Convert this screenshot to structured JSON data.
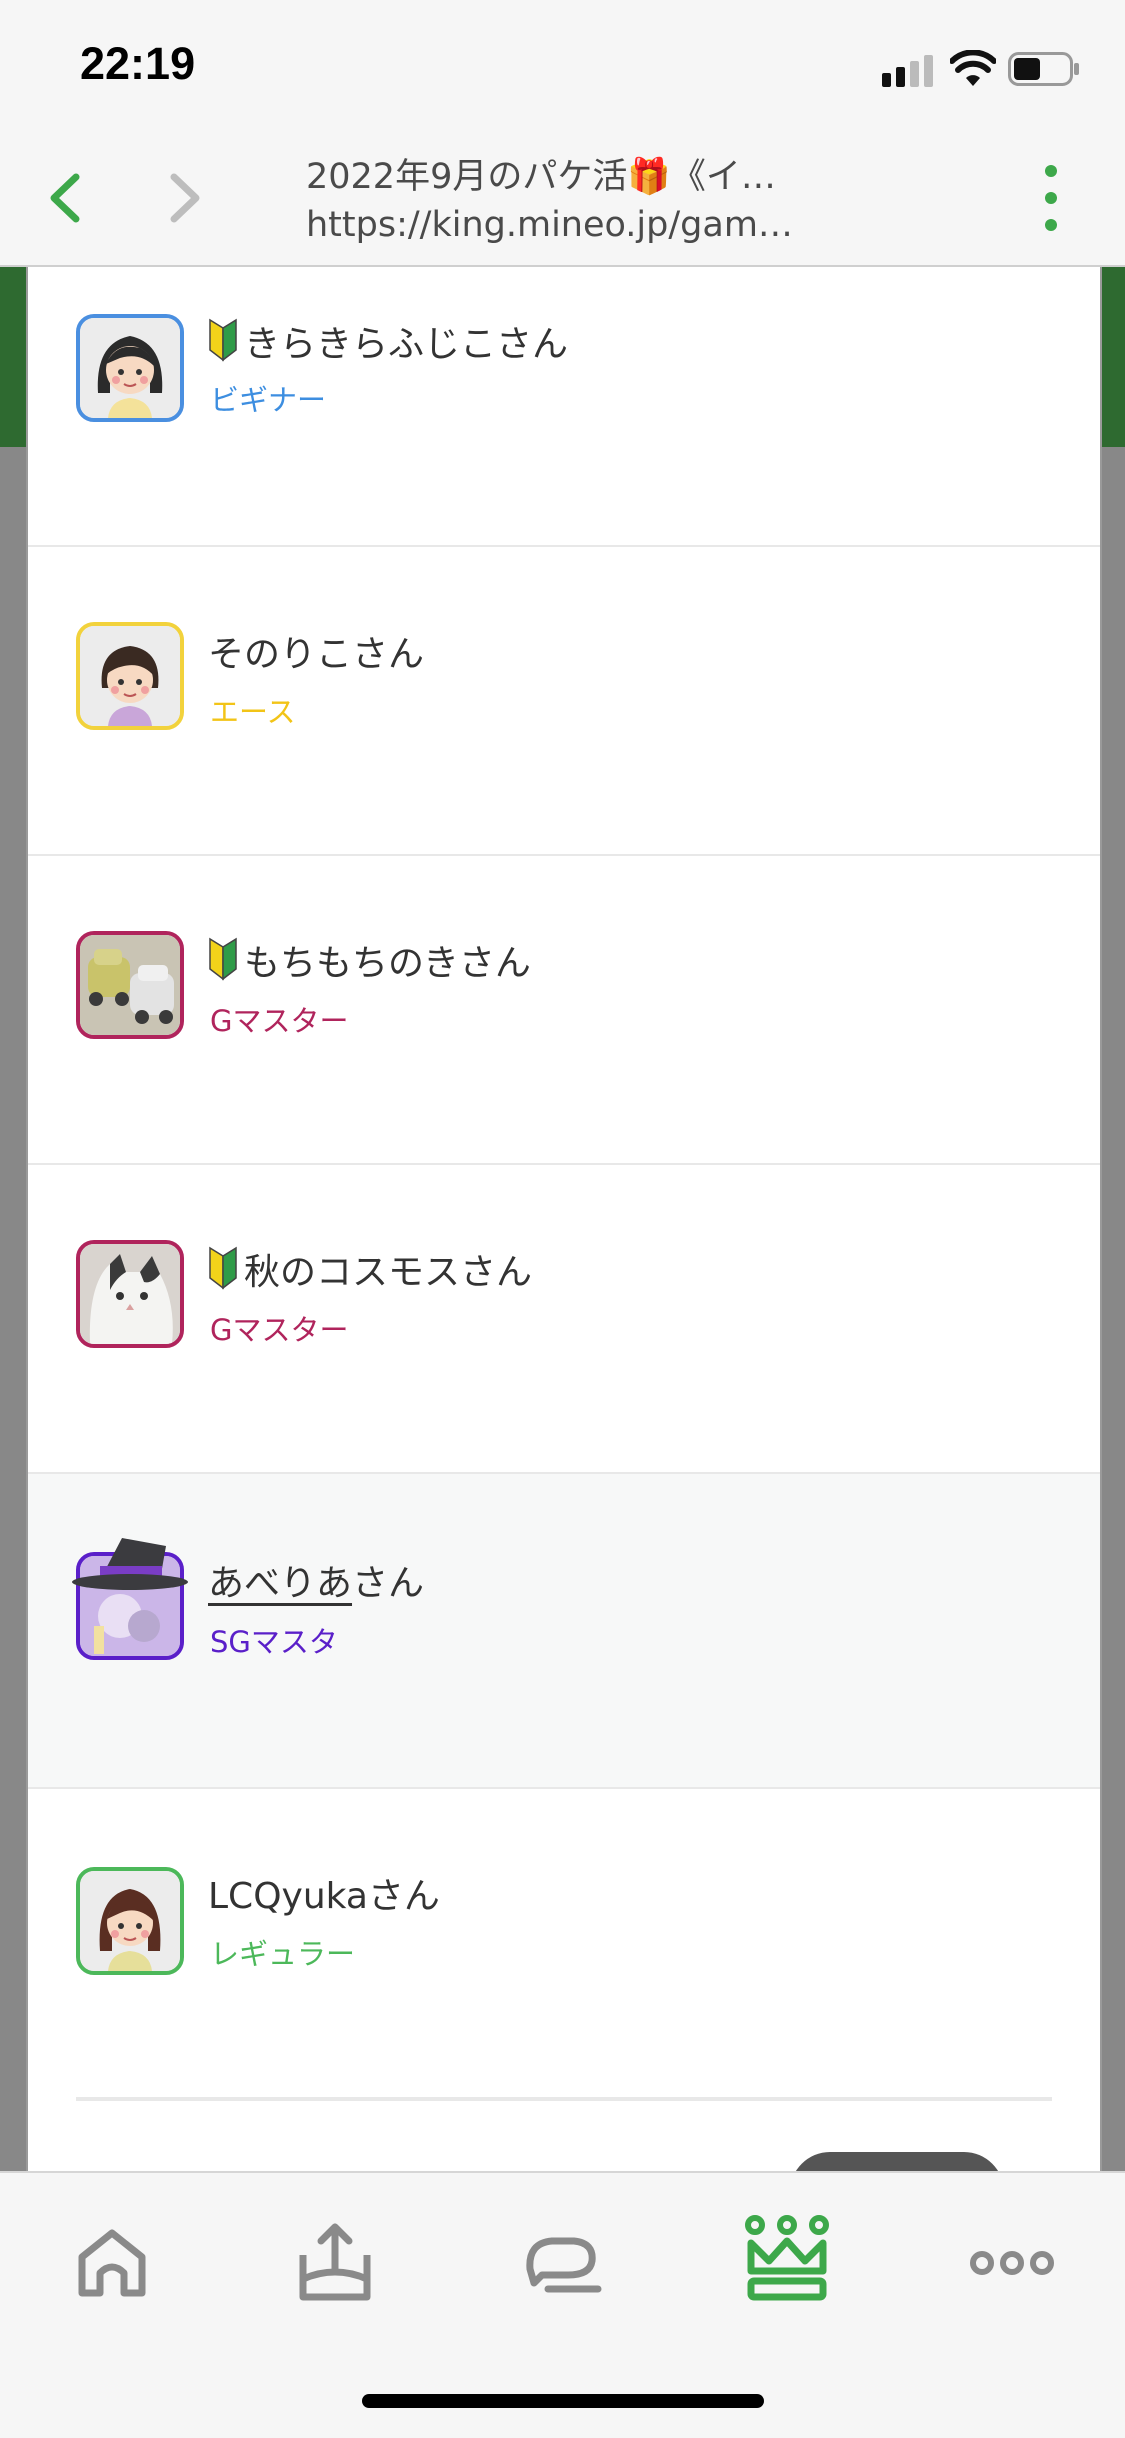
{
  "status_bar": {
    "time": "22:19"
  },
  "browser": {
    "title": "2022年9月のパケ活🎁《イ…",
    "url": "https://king.mineo.jp/gam…"
  },
  "users": [
    {
      "name": "きらきらふじこさん",
      "rank": "ビギナー",
      "rank_color": "#3d8ee0",
      "beginner_mark": true
    },
    {
      "name": "そのりこさん",
      "rank": "エース",
      "rank_color": "#f2c417",
      "beginner_mark": false
    },
    {
      "name": "もちもちのきさん",
      "rank": "Gマスター",
      "rank_color": "#b0245c",
      "beginner_mark": true
    },
    {
      "name": "秋のコスモスさん",
      "rank": "Gマスター",
      "rank_color": "#b0245c",
      "beginner_mark": true
    },
    {
      "name_underlined": "あべりあ",
      "name_suffix": "さん",
      "rank": "SGマスタ",
      "rank_color": "#5a1fc9",
      "beginner_mark": false
    },
    {
      "name": "LCQyukaさん",
      "rank": "レギュラー",
      "rank_color": "#4cb85a",
      "beginner_mark": false
    }
  ],
  "tab_bar": {
    "items": [
      "home-icon",
      "upload-icon",
      "chat-icon",
      "crown-icon",
      "more-icon"
    ],
    "active_color": "#3da84a",
    "inactive_color": "#8a8a8a"
  }
}
